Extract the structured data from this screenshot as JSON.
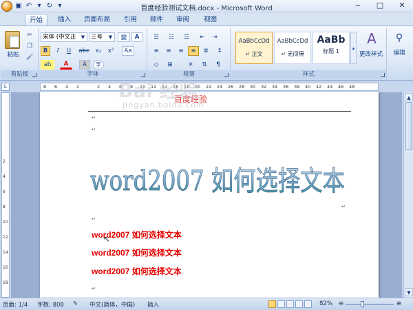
{
  "window": {
    "title": "百度经验测试文档.docx - Microsoft Word",
    "controls": [
      "−",
      "□",
      "✕"
    ]
  },
  "tabs": [
    "开始",
    "插入",
    "页面布局",
    "引用",
    "邮件",
    "审阅",
    "视图"
  ],
  "ribbon": {
    "clipboard": {
      "label": "剪贴板",
      "paste": "粘贴"
    },
    "font": {
      "label": "字体",
      "font_name": "宋体 (中文正",
      "font_size": "三号",
      "font_size_char": "變",
      "font_letter": "A",
      "bold": "B",
      "italic": "I",
      "underline": "U",
      "strike": "abc",
      "subscript": "x₂",
      "superscript": "x²",
      "clear": "Aa",
      "highlight": "ab",
      "font_color": "A",
      "shade": "A",
      "enclose": "字"
    },
    "paragraph": {
      "label": "段落"
    },
    "styles": {
      "label": "样式",
      "items": [
        {
          "sample": "AaBbCcDd",
          "name": "↵ 正文"
        },
        {
          "sample": "AaBbCcDd",
          "name": "↵ 无间隔"
        },
        {
          "sample": "AaBb",
          "name": "标题 1"
        }
      ],
      "change_styles": "更改样式"
    },
    "edit": {
      "label": "编辑"
    }
  },
  "ruler": {
    "numbers": [
      "8",
      "6",
      "4",
      "2",
      "2",
      "4",
      "6",
      "8",
      "10",
      "12",
      "14",
      "16",
      "18",
      "20",
      "22",
      "24",
      "26",
      "28",
      "30",
      "32",
      "34",
      "36",
      "38",
      "40",
      "42",
      "44",
      "46",
      "48"
    ],
    "tab_mark": "L"
  },
  "vruler": {
    "numbers": [
      "2",
      "4",
      "6",
      "8",
      "10",
      "12",
      "14",
      "16",
      "18"
    ]
  },
  "document": {
    "header": "百度经验",
    "wordart": "word2007 如何选择文本",
    "lines": [
      "word2007 如何选择文本",
      "word2007 如何选择文本",
      "word2007 如何选择文本"
    ],
    "para_mark": "↵"
  },
  "watermark": {
    "main": "Bai 经验",
    "sub": "jingyan.baidu.com"
  },
  "status": {
    "page": "页面: 1/4",
    "words": "字数: 808",
    "language": "中文(简体，中国)",
    "mode": "插入",
    "zoom": "82%"
  },
  "colors": {
    "accent": "#15428b",
    "red_text": "#e60000",
    "header_red": "#e23b3b"
  }
}
